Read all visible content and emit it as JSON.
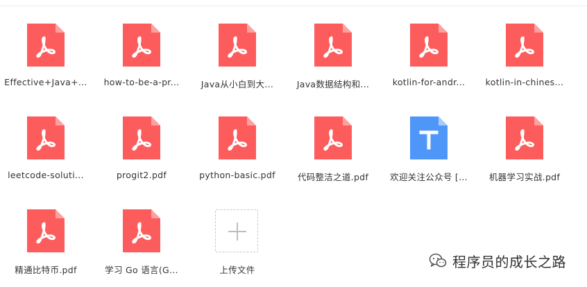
{
  "files": [
    {
      "name": "Effective+Java+...",
      "type": "pdf"
    },
    {
      "name": "how-to-be-a-pr...",
      "type": "pdf"
    },
    {
      "name": "Java从小白到大...",
      "type": "pdf"
    },
    {
      "name": "Java数据结构和...",
      "type": "pdf"
    },
    {
      "name": "kotlin-for-andr...",
      "type": "pdf"
    },
    {
      "name": "kotlin-in-chines...",
      "type": "pdf"
    },
    {
      "name": "leetcode-soluti...",
      "type": "pdf"
    },
    {
      "name": "progit2.pdf",
      "type": "pdf"
    },
    {
      "name": "python-basic.pdf",
      "type": "pdf"
    },
    {
      "name": "代码整洁之道.pdf",
      "type": "pdf"
    },
    {
      "name": "欢迎关注公众号 [...",
      "type": "text"
    },
    {
      "name": "机器学习实战.pdf",
      "type": "pdf"
    },
    {
      "name": "精通比特币.pdf",
      "type": "pdf"
    },
    {
      "name": "学习 Go 语言(G...",
      "type": "pdf"
    }
  ],
  "upload": {
    "label": "上传文件",
    "icon": "plus-icon"
  },
  "watermark": {
    "text": "程序员的成长之路",
    "icon": "wechat-icon"
  },
  "colors": {
    "pdf": "#fc5c5c",
    "pdf_fold": "#fda0a0",
    "text": "#4e97f9",
    "text_fold": "#a8cbfc"
  }
}
